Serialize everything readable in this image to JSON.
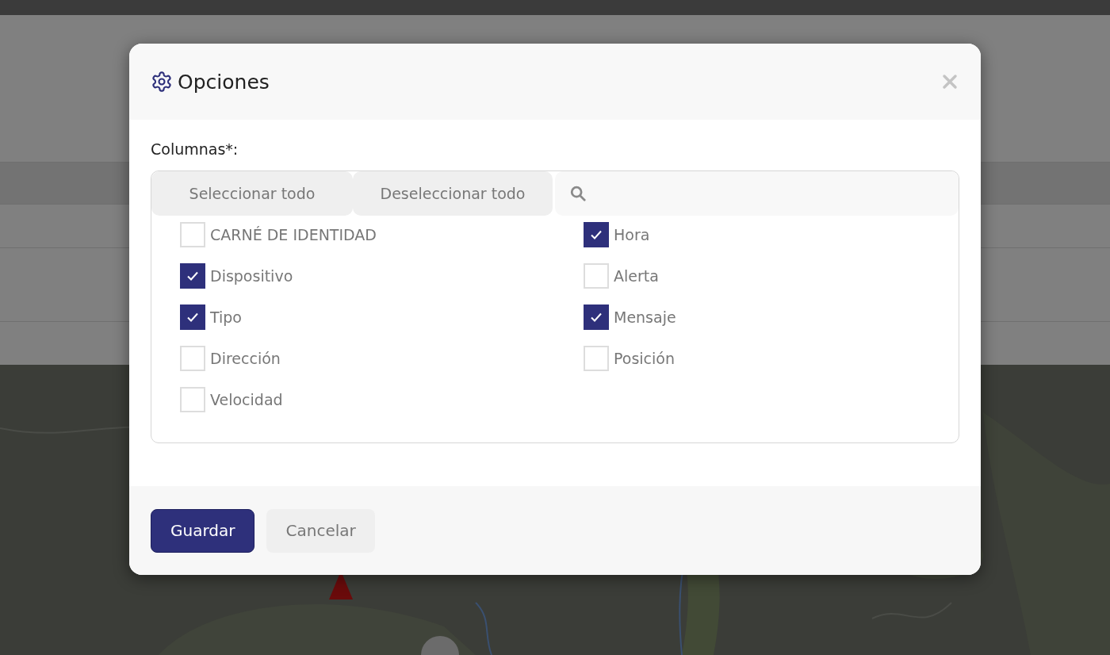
{
  "dialog": {
    "title": "Opciones",
    "field_label": "Columnas*:",
    "toolbar": {
      "select_all": "Seleccionar todo",
      "deselect_all": "Deseleccionar todo"
    },
    "options": [
      {
        "label": "CARNÉ DE IDENTIDAD",
        "checked": false
      },
      {
        "label": "Hora",
        "checked": true
      },
      {
        "label": "Dispositivo",
        "checked": true
      },
      {
        "label": "Alerta",
        "checked": false
      },
      {
        "label": "Tipo",
        "checked": true
      },
      {
        "label": "Mensaje",
        "checked": true
      },
      {
        "label": "Dirección",
        "checked": false
      },
      {
        "label": "Posición",
        "checked": false
      },
      {
        "label": "Velocidad",
        "checked": false
      }
    ],
    "buttons": [
      {
        "label": "Guardar",
        "kind": "primary"
      },
      {
        "label": "Cancelar",
        "kind": "secondary"
      }
    ]
  }
}
